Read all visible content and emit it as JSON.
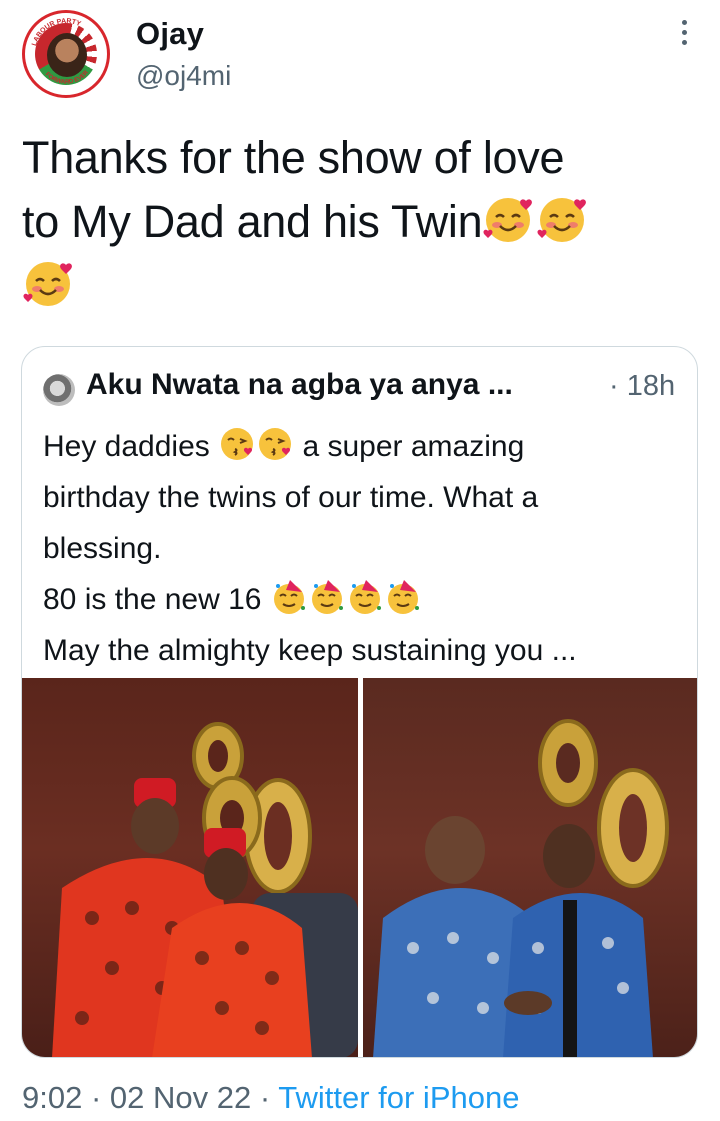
{
  "author": {
    "name": "Ojay",
    "handle": "@oj4mi",
    "avatar_ring_text": "LABOUR PARTY · FORWARD EVER"
  },
  "tweet": {
    "line1": "Thanks for the show of love",
    "line2": "to My Dad and his Twin",
    "emojis": [
      "smiling-face-with-hearts",
      "smiling-face-with-hearts",
      "smiling-face-with-hearts"
    ]
  },
  "quoted": {
    "name": "Aku Nwata na agba ya anya ...",
    "time": "· 18h",
    "text": {
      "line1_a": "Hey daddies",
      "line1_b": "a super amazing",
      "line2": "birthday the twins of our time. What a",
      "line3": "blessing.",
      "line4": "80 is the new 16",
      "line5": "May the almighty keep sustaining you ..."
    },
    "photos": [
      "twins-in-red-attire-with-80-balloons",
      "twins-in-blue-attire-with-80-balloons"
    ]
  },
  "meta": {
    "time": "9:02",
    "sep1": " · ",
    "date": "02 Nov 22",
    "sep2": " · ",
    "source": "Twitter for iPhone"
  },
  "colors": {
    "link": "#1d9bf0",
    "secondary": "#536471",
    "border": "#cfd9de",
    "party_red": "#c7272d",
    "party_green": "#2f9a42"
  }
}
